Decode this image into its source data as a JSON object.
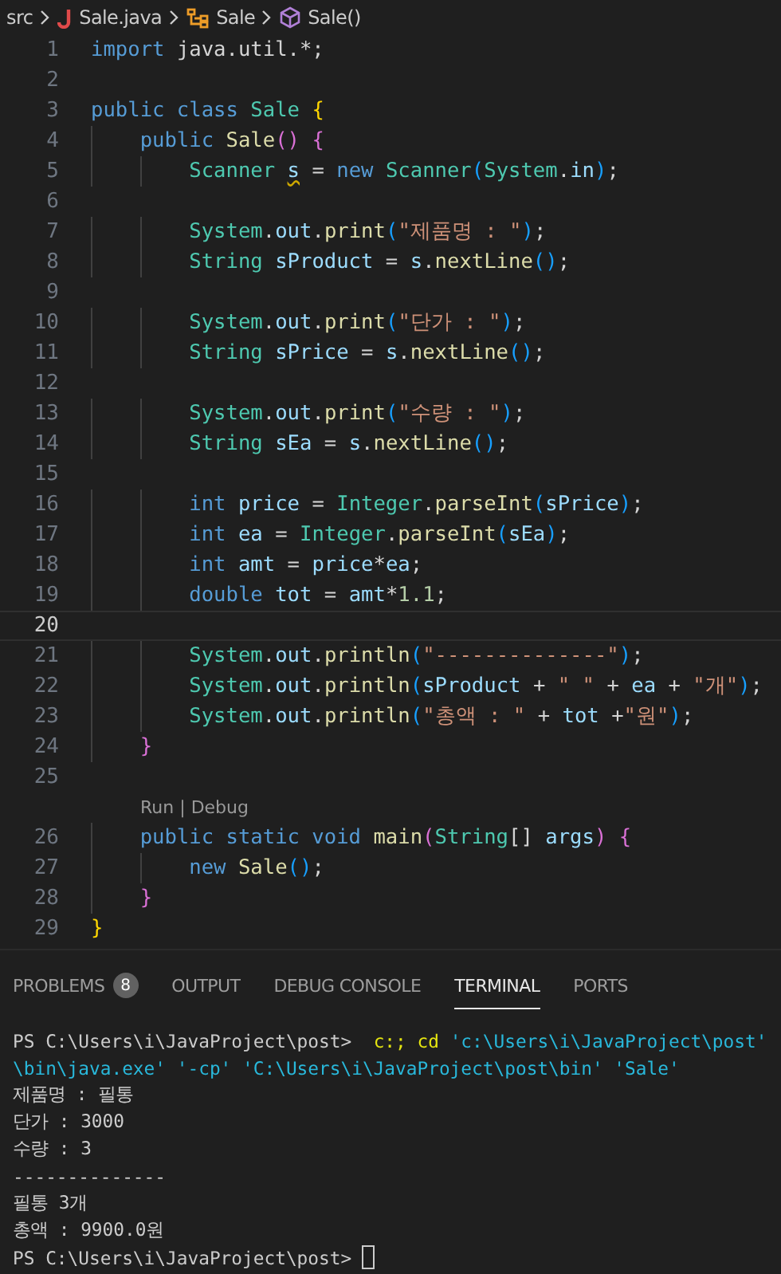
{
  "breadcrumb": [
    {
      "kind": "folder",
      "label": "src"
    },
    {
      "kind": "java-file",
      "label": "Sale.java"
    },
    {
      "kind": "class",
      "label": "Sale"
    },
    {
      "kind": "method",
      "label": "Sale()"
    }
  ],
  "editor": {
    "lines": [
      {
        "kind": "code",
        "n": "1",
        "tokens": [
          {
            "kind": "kw",
            "text": "import"
          },
          {
            "kind": "plain",
            "text": " java.util.*;"
          }
        ]
      },
      {
        "kind": "code",
        "n": "2"
      },
      {
        "kind": "code",
        "n": "3",
        "tokens": [
          {
            "kind": "kw",
            "text": "public class "
          },
          {
            "kind": "type",
            "text": "Sale "
          },
          {
            "kind": "b1",
            "text": "{"
          }
        ]
      },
      {
        "kind": "code",
        "n": "4",
        "tokens": [
          {
            "kind": "kw",
            "text": "    public "
          },
          {
            "kind": "fn",
            "text": "Sale"
          },
          {
            "kind": "b2",
            "text": "() {"
          }
        ]
      },
      {
        "kind": "code",
        "n": "5",
        "tokens": [
          {
            "kind": "type",
            "text": "        Scanner "
          },
          {
            "kind": "warn",
            "text": "s"
          },
          {
            "kind": "plain",
            "text": " = "
          },
          {
            "kind": "kw",
            "text": "new "
          },
          {
            "kind": "type",
            "text": "Scanner"
          },
          {
            "kind": "b3",
            "text": "("
          },
          {
            "kind": "type",
            "text": "System"
          },
          {
            "kind": "plain",
            "text": "."
          },
          {
            "kind": "var",
            "text": "in"
          },
          {
            "kind": "b3",
            "text": ")"
          },
          {
            "kind": "plain",
            "text": ";"
          }
        ]
      },
      {
        "kind": "code",
        "n": "6"
      },
      {
        "kind": "code",
        "n": "7",
        "tokens": [
          {
            "kind": "type",
            "text": "        System"
          },
          {
            "kind": "plain",
            "text": "."
          },
          {
            "kind": "var",
            "text": "out"
          },
          {
            "kind": "plain",
            "text": "."
          },
          {
            "kind": "fn",
            "text": "print"
          },
          {
            "kind": "b3",
            "text": "("
          },
          {
            "kind": "str",
            "text": "\"제품명 : \""
          },
          {
            "kind": "b3",
            "text": ")"
          },
          {
            "kind": "plain",
            "text": ";"
          }
        ]
      },
      {
        "kind": "code",
        "n": "8",
        "tokens": [
          {
            "kind": "type",
            "text": "        String "
          },
          {
            "kind": "var",
            "text": "sProduct"
          },
          {
            "kind": "plain",
            "text": " = "
          },
          {
            "kind": "var",
            "text": "s"
          },
          {
            "kind": "plain",
            "text": "."
          },
          {
            "kind": "fn",
            "text": "nextLine"
          },
          {
            "kind": "b3",
            "text": "()"
          },
          {
            "kind": "plain",
            "text": ";"
          }
        ]
      },
      {
        "kind": "code",
        "n": "9"
      },
      {
        "kind": "code",
        "n": "10",
        "tokens": [
          {
            "kind": "type",
            "text": "        System"
          },
          {
            "kind": "plain",
            "text": "."
          },
          {
            "kind": "var",
            "text": "out"
          },
          {
            "kind": "plain",
            "text": "."
          },
          {
            "kind": "fn",
            "text": "print"
          },
          {
            "kind": "b3",
            "text": "("
          },
          {
            "kind": "str",
            "text": "\"단가 : \""
          },
          {
            "kind": "b3",
            "text": ")"
          },
          {
            "kind": "plain",
            "text": ";"
          }
        ]
      },
      {
        "kind": "code",
        "n": "11",
        "tokens": [
          {
            "kind": "type",
            "text": "        String "
          },
          {
            "kind": "var",
            "text": "sPrice"
          },
          {
            "kind": "plain",
            "text": " = "
          },
          {
            "kind": "var",
            "text": "s"
          },
          {
            "kind": "plain",
            "text": "."
          },
          {
            "kind": "fn",
            "text": "nextLine"
          },
          {
            "kind": "b3",
            "text": "()"
          },
          {
            "kind": "plain",
            "text": ";"
          }
        ]
      },
      {
        "kind": "code",
        "n": "12"
      },
      {
        "kind": "code",
        "n": "13",
        "tokens": [
          {
            "kind": "type",
            "text": "        System"
          },
          {
            "kind": "plain",
            "text": "."
          },
          {
            "kind": "var",
            "text": "out"
          },
          {
            "kind": "plain",
            "text": "."
          },
          {
            "kind": "fn",
            "text": "print"
          },
          {
            "kind": "b3",
            "text": "("
          },
          {
            "kind": "str",
            "text": "\"수량 : \""
          },
          {
            "kind": "b3",
            "text": ")"
          },
          {
            "kind": "plain",
            "text": ";"
          }
        ]
      },
      {
        "kind": "code",
        "n": "14",
        "tokens": [
          {
            "kind": "type",
            "text": "        String "
          },
          {
            "kind": "var",
            "text": "sEa"
          },
          {
            "kind": "plain",
            "text": " = "
          },
          {
            "kind": "var",
            "text": "s"
          },
          {
            "kind": "plain",
            "text": "."
          },
          {
            "kind": "fn",
            "text": "nextLine"
          },
          {
            "kind": "b3",
            "text": "()"
          },
          {
            "kind": "plain",
            "text": ";"
          }
        ]
      },
      {
        "kind": "code",
        "n": "15"
      },
      {
        "kind": "code",
        "n": "16",
        "tokens": [
          {
            "kind": "kw",
            "text": "        int "
          },
          {
            "kind": "var",
            "text": "price"
          },
          {
            "kind": "plain",
            "text": " = "
          },
          {
            "kind": "type",
            "text": "Integer"
          },
          {
            "kind": "plain",
            "text": "."
          },
          {
            "kind": "fn",
            "text": "parseInt"
          },
          {
            "kind": "b3",
            "text": "("
          },
          {
            "kind": "var",
            "text": "sPrice"
          },
          {
            "kind": "b3",
            "text": ")"
          },
          {
            "kind": "plain",
            "text": ";"
          }
        ]
      },
      {
        "kind": "code",
        "n": "17",
        "tokens": [
          {
            "kind": "kw",
            "text": "        int "
          },
          {
            "kind": "var",
            "text": "ea"
          },
          {
            "kind": "plain",
            "text": " = "
          },
          {
            "kind": "type",
            "text": "Integer"
          },
          {
            "kind": "plain",
            "text": "."
          },
          {
            "kind": "fn",
            "text": "parseInt"
          },
          {
            "kind": "b3",
            "text": "("
          },
          {
            "kind": "var",
            "text": "sEa"
          },
          {
            "kind": "b3",
            "text": ")"
          },
          {
            "kind": "plain",
            "text": ";"
          }
        ]
      },
      {
        "kind": "code",
        "n": "18",
        "tokens": [
          {
            "kind": "kw",
            "text": "        int "
          },
          {
            "kind": "var",
            "text": "amt"
          },
          {
            "kind": "plain",
            "text": " = "
          },
          {
            "kind": "var",
            "text": "price"
          },
          {
            "kind": "plain",
            "text": "*"
          },
          {
            "kind": "var",
            "text": "ea"
          },
          {
            "kind": "plain",
            "text": ";"
          }
        ]
      },
      {
        "kind": "code",
        "n": "19",
        "tokens": [
          {
            "kind": "kw",
            "text": "        double "
          },
          {
            "kind": "var",
            "text": "tot"
          },
          {
            "kind": "plain",
            "text": " = "
          },
          {
            "kind": "var",
            "text": "amt"
          },
          {
            "kind": "plain",
            "text": "*"
          },
          {
            "kind": "num",
            "text": "1.1"
          },
          {
            "kind": "plain",
            "text": ";"
          }
        ]
      },
      {
        "kind": "code",
        "n": "20",
        "current": true
      },
      {
        "kind": "code",
        "n": "21",
        "tokens": [
          {
            "kind": "type",
            "text": "        System"
          },
          {
            "kind": "plain",
            "text": "."
          },
          {
            "kind": "var",
            "text": "out"
          },
          {
            "kind": "plain",
            "text": "."
          },
          {
            "kind": "fn",
            "text": "println"
          },
          {
            "kind": "b3",
            "text": "("
          },
          {
            "kind": "str",
            "text": "\"--------------\""
          },
          {
            "kind": "b3",
            "text": ")"
          },
          {
            "kind": "plain",
            "text": ";"
          }
        ]
      },
      {
        "kind": "code",
        "n": "22",
        "tokens": [
          {
            "kind": "type",
            "text": "        System"
          },
          {
            "kind": "plain",
            "text": "."
          },
          {
            "kind": "var",
            "text": "out"
          },
          {
            "kind": "plain",
            "text": "."
          },
          {
            "kind": "fn",
            "text": "println"
          },
          {
            "kind": "b3",
            "text": "("
          },
          {
            "kind": "var",
            "text": "sProduct"
          },
          {
            "kind": "plain",
            "text": " + "
          },
          {
            "kind": "str",
            "text": "\" \""
          },
          {
            "kind": "plain",
            "text": " + "
          },
          {
            "kind": "var",
            "text": "ea"
          },
          {
            "kind": "plain",
            "text": " + "
          },
          {
            "kind": "str",
            "text": "\"개\""
          },
          {
            "kind": "b3",
            "text": ")"
          },
          {
            "kind": "plain",
            "text": ";"
          }
        ]
      },
      {
        "kind": "code",
        "n": "23",
        "tokens": [
          {
            "kind": "type",
            "text": "        System"
          },
          {
            "kind": "plain",
            "text": "."
          },
          {
            "kind": "var",
            "text": "out"
          },
          {
            "kind": "plain",
            "text": "."
          },
          {
            "kind": "fn",
            "text": "println"
          },
          {
            "kind": "b3",
            "text": "("
          },
          {
            "kind": "str",
            "text": "\"총액 : \""
          },
          {
            "kind": "plain",
            "text": " + "
          },
          {
            "kind": "var",
            "text": "tot"
          },
          {
            "kind": "plain",
            "text": " +"
          },
          {
            "kind": "str",
            "text": "\"원\""
          },
          {
            "kind": "b3",
            "text": ")"
          },
          {
            "kind": "plain",
            "text": ";"
          }
        ]
      },
      {
        "kind": "code",
        "n": "24",
        "tokens": [
          {
            "kind": "b2",
            "text": "    }"
          }
        ]
      },
      {
        "kind": "code",
        "n": "25"
      },
      {
        "kind": "codelens",
        "links": [
          "Run",
          "Debug"
        ],
        "separator": "|"
      },
      {
        "kind": "code",
        "n": "26",
        "tokens": [
          {
            "kind": "kw",
            "text": "    public static void "
          },
          {
            "kind": "fn",
            "text": "main"
          },
          {
            "kind": "b2",
            "text": "("
          },
          {
            "kind": "type",
            "text": "String"
          },
          {
            "kind": "plain",
            "text": "[] "
          },
          {
            "kind": "var",
            "text": "args"
          },
          {
            "kind": "b2",
            "text": ") {"
          }
        ]
      },
      {
        "kind": "code",
        "n": "27",
        "tokens": [
          {
            "kind": "kw",
            "text": "        new "
          },
          {
            "kind": "fn",
            "text": "Sale"
          },
          {
            "kind": "b3",
            "text": "()"
          },
          {
            "kind": "plain",
            "text": ";"
          }
        ]
      },
      {
        "kind": "code",
        "n": "28",
        "tokens": [
          {
            "kind": "b2",
            "text": "    }"
          }
        ]
      },
      {
        "kind": "code",
        "n": "29",
        "tokens": [
          {
            "kind": "b1",
            "text": "}"
          }
        ]
      }
    ]
  },
  "panel": {
    "tabs": [
      {
        "label": "PROBLEMS",
        "badge": "8",
        "selected": false
      },
      {
        "label": "OUTPUT",
        "selected": false
      },
      {
        "label": "DEBUG CONSOLE",
        "selected": false
      },
      {
        "label": "TERMINAL",
        "selected": true
      },
      {
        "label": "PORTS",
        "selected": false
      }
    ],
    "terminal": [
      {
        "segments": [
          {
            "kind": "plain",
            "text": "PS C:\\Users\\i\\JavaProject\\post>  "
          },
          {
            "kind": "yellow",
            "text": "c:; cd"
          },
          {
            "kind": "cyan",
            "text": " 'c:\\Users\\i\\JavaProject\\post'"
          }
        ]
      },
      {
        "segments": [
          {
            "kind": "cyan",
            "text": "\\bin\\java.exe' '-cp' 'C:\\Users\\i\\JavaProject\\post\\bin' 'Sale'"
          }
        ]
      },
      {
        "segments": [
          {
            "kind": "plain",
            "text": "제품명 : 필통"
          }
        ]
      },
      {
        "segments": [
          {
            "kind": "plain",
            "text": "단가 : 3000"
          }
        ]
      },
      {
        "segments": [
          {
            "kind": "plain",
            "text": "수량 : 3"
          }
        ]
      },
      {
        "segments": [
          {
            "kind": "plain",
            "text": "--------------"
          }
        ]
      },
      {
        "segments": [
          {
            "kind": "plain",
            "text": "필통 3개"
          }
        ]
      },
      {
        "segments": [
          {
            "kind": "plain",
            "text": "총액 : 9900.0원"
          }
        ]
      },
      {
        "segments": [
          {
            "kind": "plain",
            "text": "PS C:\\Users\\i\\JavaProject\\post> "
          }
        ],
        "cursor": true
      }
    ]
  }
}
